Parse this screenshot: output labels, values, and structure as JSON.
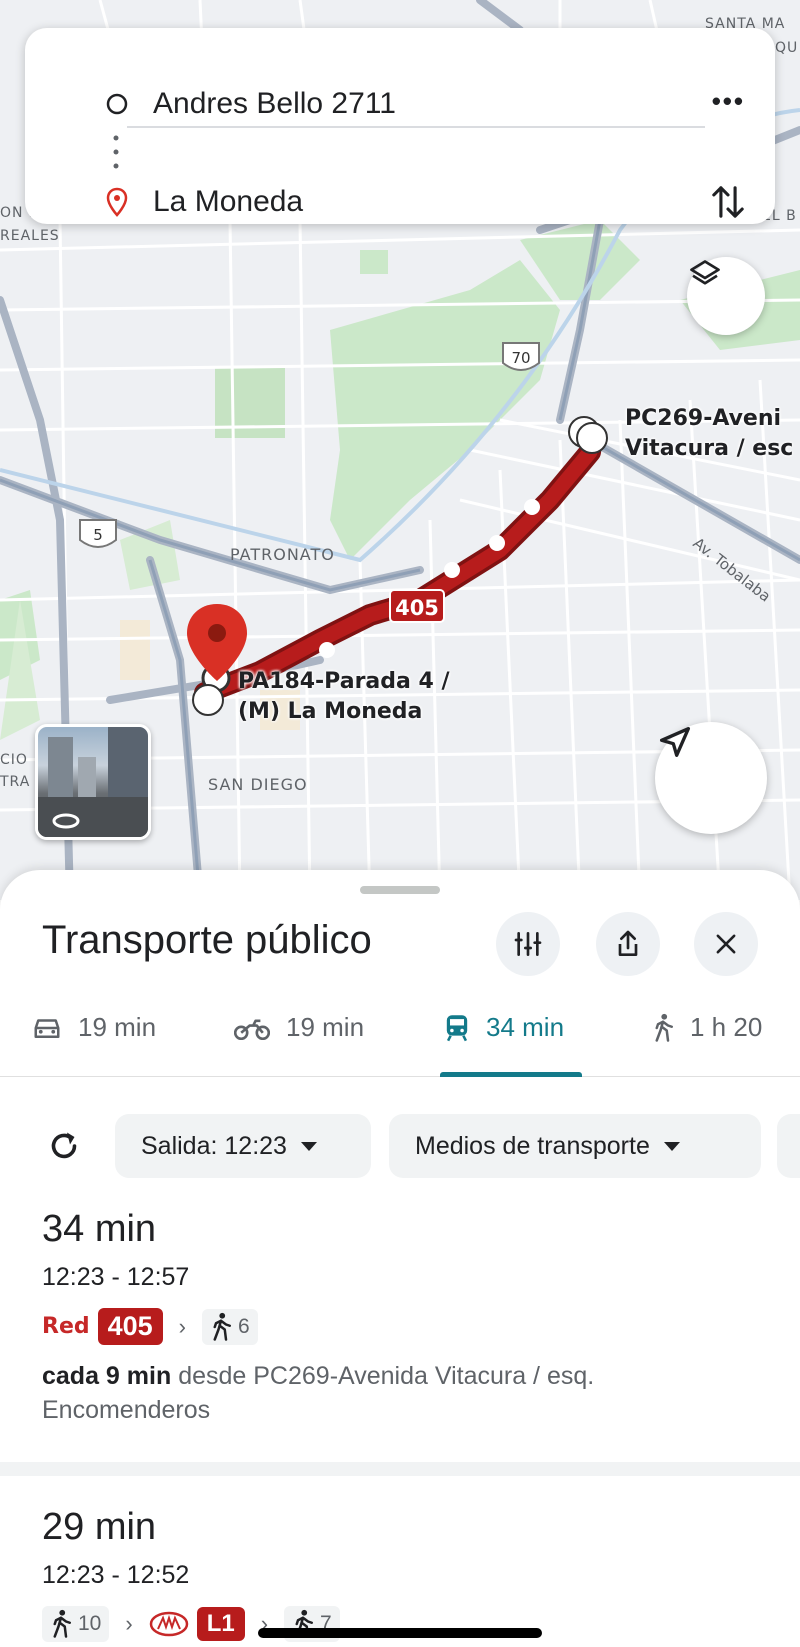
{
  "search": {
    "origin": "Andres Bello 2711",
    "destination": "La Moneda"
  },
  "map": {
    "labels": {
      "patronato": "PATRONATO",
      "san_diego": "SAN DIEGO",
      "tobalaba": "Av. Tobalaba",
      "santa_ma": "SANTA MA",
      "qu": "QU",
      "on_d": "ON D",
      "reales": "REALES",
      "el_b": "EL B",
      "cio": "CIO",
      "tra": "TRA"
    },
    "highway_shields": [
      "70",
      "5"
    ],
    "route_badge": "405",
    "route_color": "#b71c1c",
    "stop_origin": [
      "PC269-Aveni",
      "Vitacura / esc"
    ],
    "stop_destination": [
      "PA184-Parada 4 /",
      "(M) La Moneda"
    ]
  },
  "sheet": {
    "title": "Transporte público",
    "modes": [
      {
        "icon": "car-icon",
        "label": "19 min"
      },
      {
        "icon": "motorcycle-icon",
        "label": "19 min"
      },
      {
        "icon": "transit-icon",
        "label": "34 min",
        "active": true
      },
      {
        "icon": "walk-icon",
        "label": "1 h 20"
      }
    ],
    "filters": {
      "departure": "Salida: 12:23",
      "transport": "Medios de transporte"
    },
    "routes": [
      {
        "duration": "34 min",
        "time": "12:23 - 12:57",
        "operator": "Red",
        "line": "405",
        "walk": "6",
        "freq_bold": "cada 9 min",
        "freq_rest": "desde PC269-Avenida Vitacura / esq. Encomenderos"
      },
      {
        "duration": "29 min",
        "time": "12:23 - 12:52",
        "walk": "10",
        "line": "L1",
        "walk2": "7"
      }
    ]
  },
  "colors": {
    "accent": "#137a8a",
    "pin": "#d93025",
    "bus": "#b71c1c"
  }
}
